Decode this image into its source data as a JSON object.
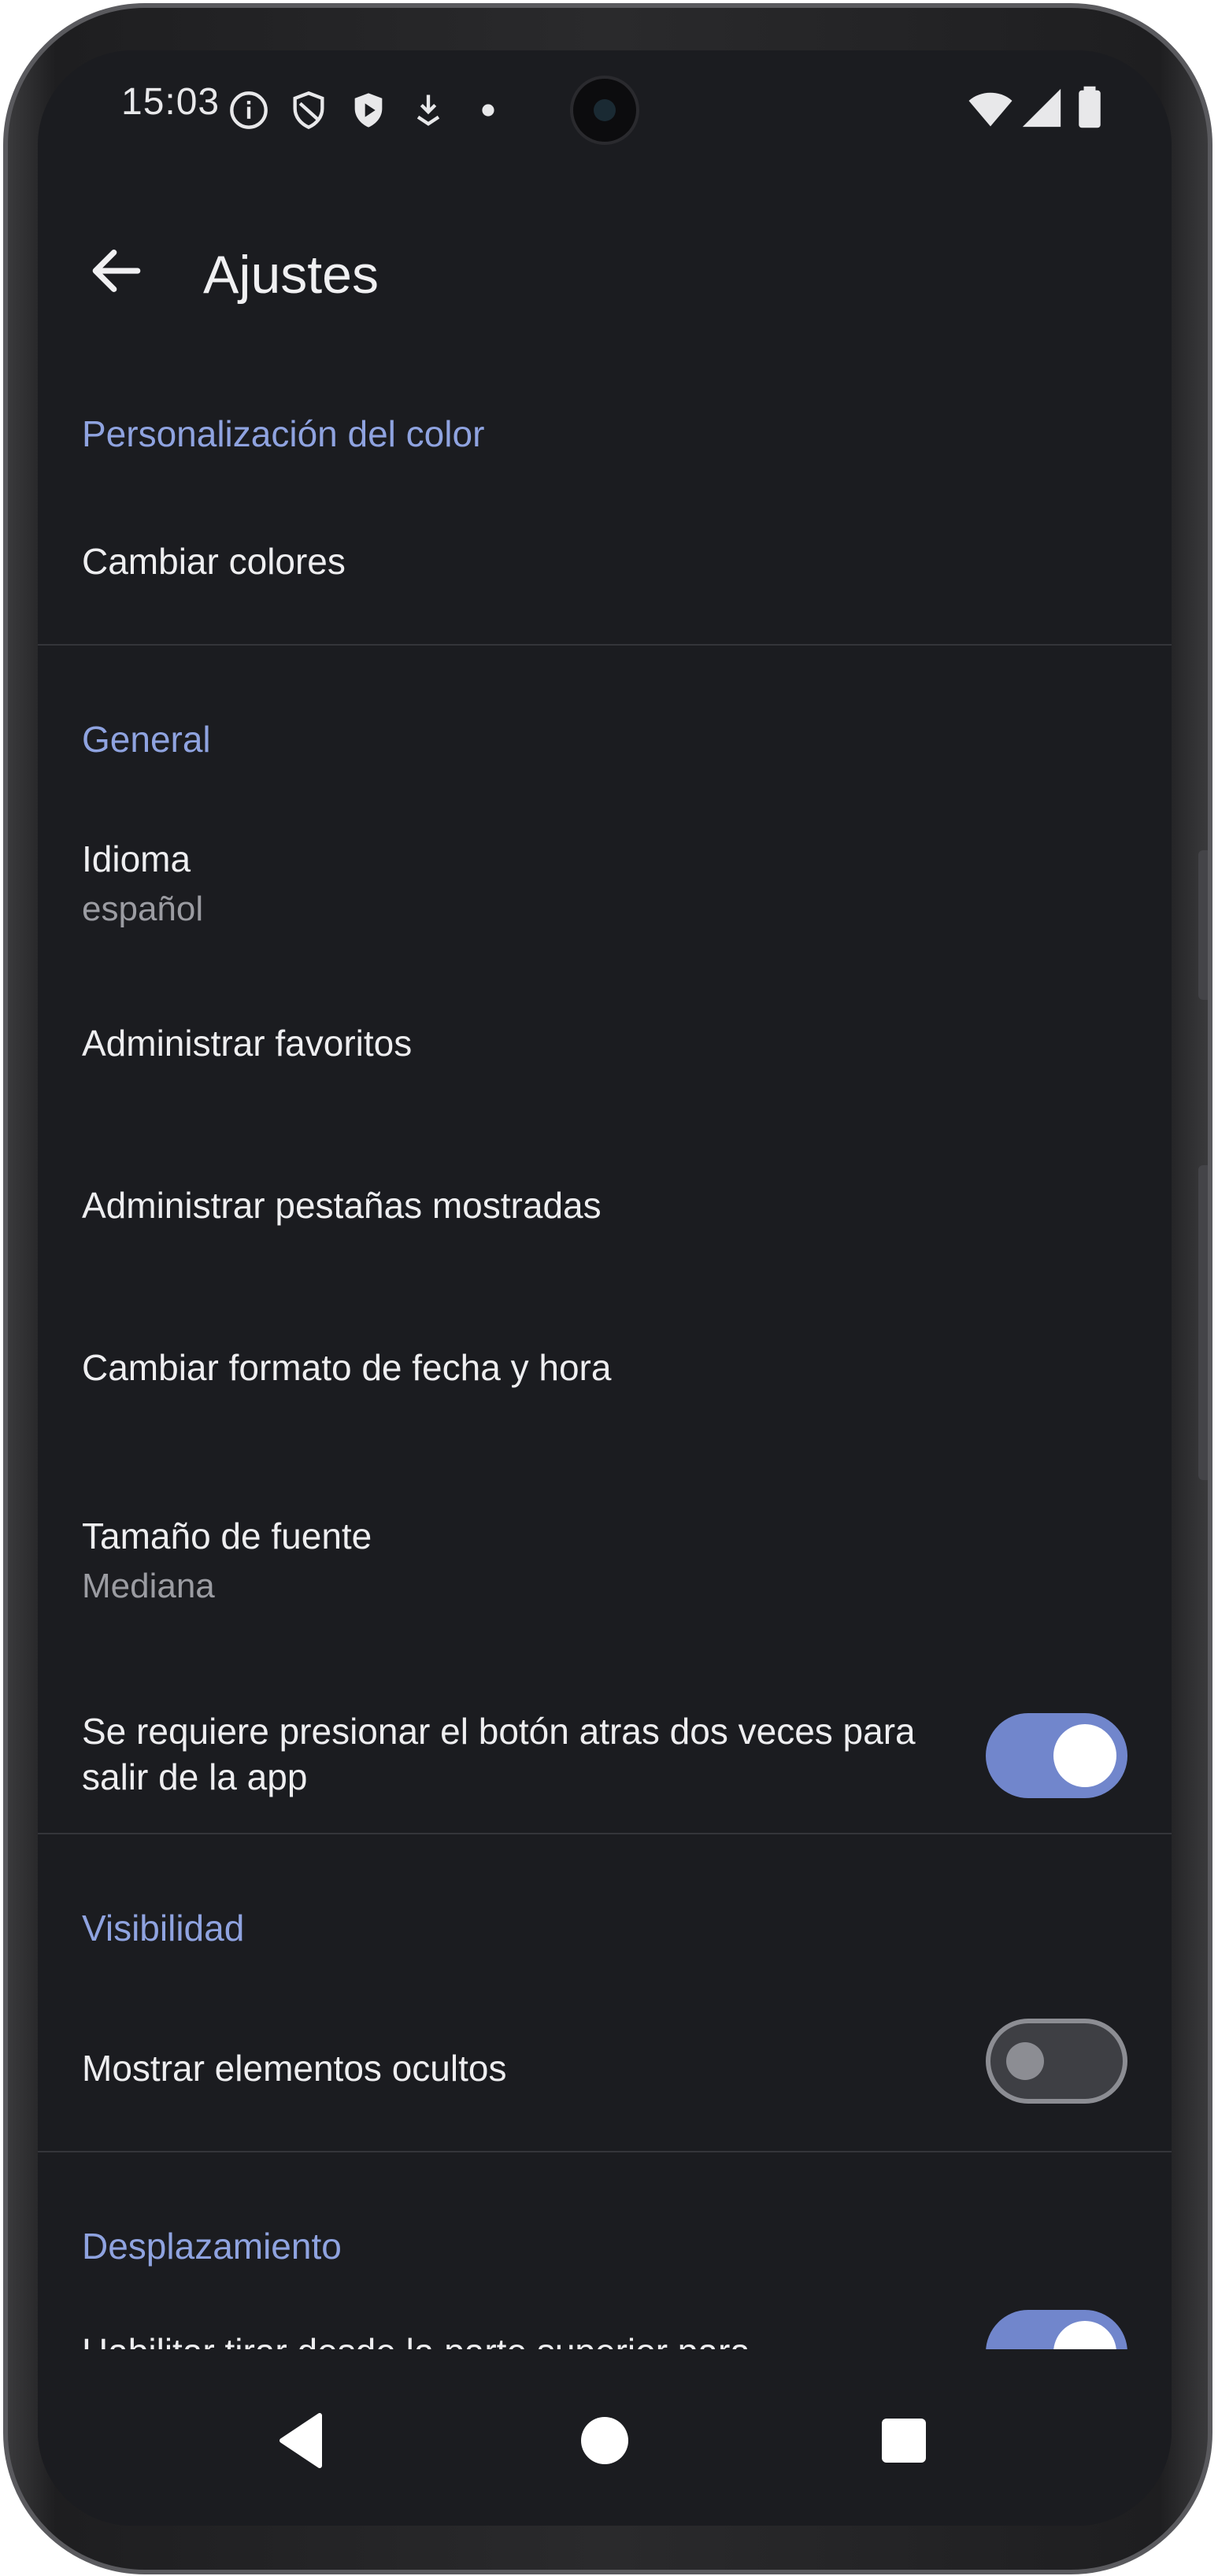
{
  "status_bar": {
    "time": "15:03",
    "icons": [
      "info-icon",
      "shield-outline-icon",
      "shield-play-icon",
      "download-icon",
      "dot-icon"
    ],
    "right_icons": [
      "wifi-icon",
      "signal-icon",
      "battery-icon"
    ]
  },
  "app_bar": {
    "back_icon": "arrow-back-icon",
    "title": "Ajustes"
  },
  "sections": {
    "color": {
      "header": "Personalización del color",
      "change_colors": "Cambiar colores"
    },
    "general": {
      "header": "General",
      "language_title": "Idioma",
      "language_value": "español",
      "manage_favorites": "Administrar favoritos",
      "manage_tabs": "Administrar pestañas mostradas",
      "date_format": "Cambiar formato de fecha y hora",
      "font_size_title": "Tamaño de fuente",
      "font_size_value": "Mediana",
      "press_back_twice": "Se requiere presionar el botón atras dos veces para salir de la app",
      "press_back_twice_enabled": true
    },
    "visibility": {
      "header": "Visibilidad",
      "show_hidden": "Mostrar elementos ocultos",
      "show_hidden_enabled": false
    },
    "scrolling": {
      "header": "Desplazamiento",
      "pull_to_refresh": "Habilitar tirar desde la parte superior para",
      "pull_to_refresh_enabled": true
    }
  },
  "nav_bar": {
    "icons": [
      "back-triangle-icon",
      "home-circle-icon",
      "recents-square-icon"
    ]
  },
  "colors": {
    "accent": "#7186cc",
    "section_header": "#8fa3e0",
    "background": "#1b1c20"
  }
}
